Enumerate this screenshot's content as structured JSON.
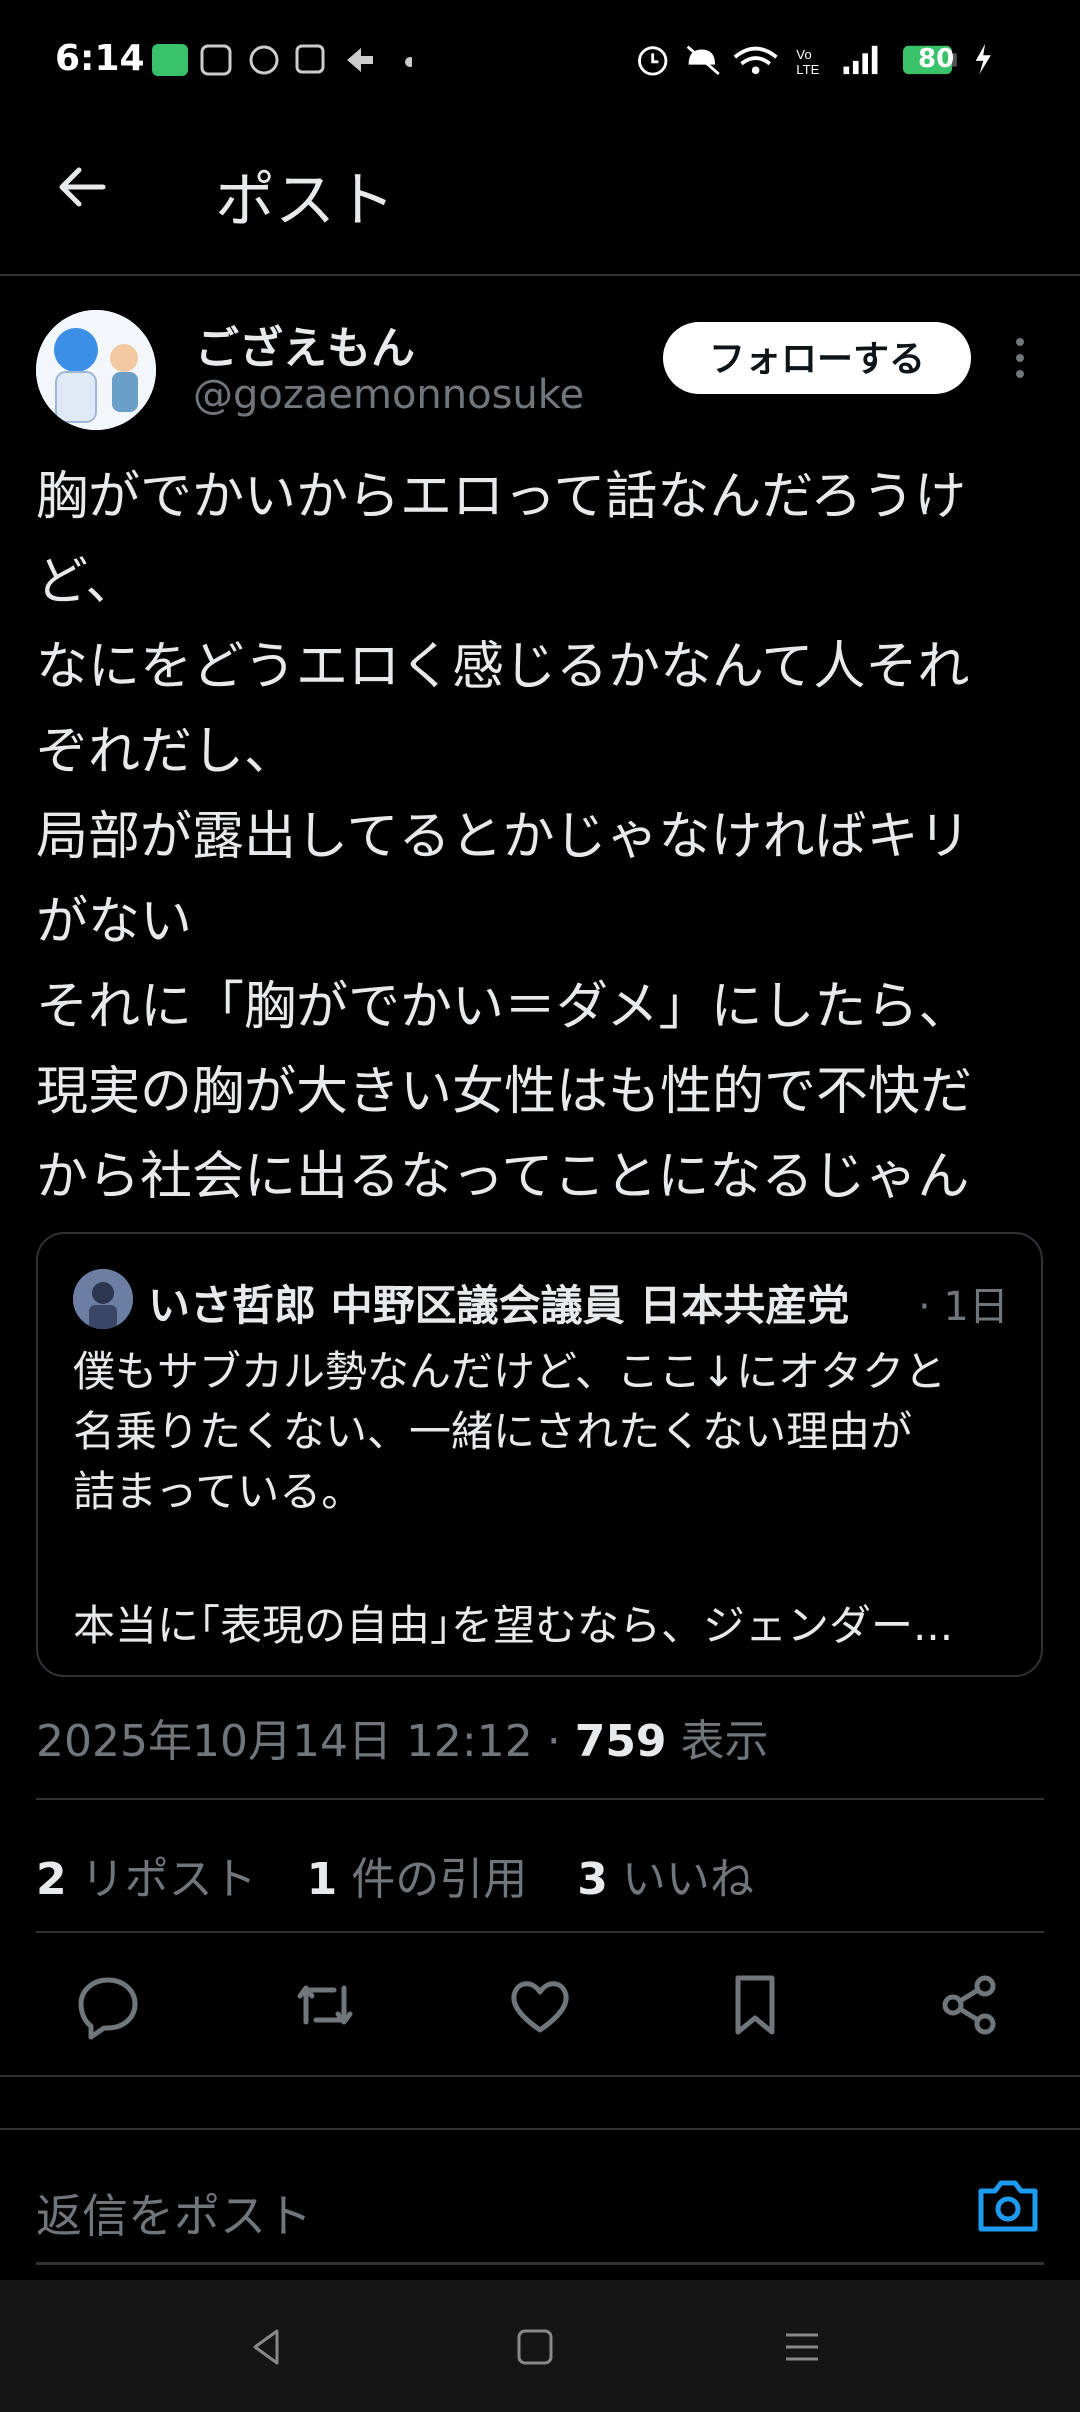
{
  "status_bar": {
    "time": "6:14",
    "battery": "80",
    "icons": [
      "notification-icon",
      "wifi-icon",
      "alarm-icon",
      "mute-icon",
      "volte-icon",
      "signal-icon",
      "battery-icon",
      "charging-icon"
    ]
  },
  "header": {
    "title": "ポスト"
  },
  "post": {
    "display_name": "ござえもん",
    "handle": "@gozaemonnosuke",
    "follow_label": "フォローする",
    "text_lines": [
      "胸がでかいからエロって話なんだろうけ",
      "ど、",
      "なにをどうエロく感じるかなんて人それ",
      "ぞれだし、",
      "局部が露出してるとかじゃなければキリ",
      "がない",
      "それに「胸がでかい＝ダメ」にしたら、",
      "現実の胸が大きい女性はも性的で不快だ",
      "から社会に出るなってことになるじゃん"
    ],
    "quote": {
      "author": "いさ哲郎 中野区議会議員 日本共産党",
      "time": "· 1日",
      "lines": [
        "僕もサブカル勢なんだけど、ここ↓にオタクと",
        "名乗りたくない、一緒にされたくない理由が",
        "詰まっている。"
      ],
      "last_line": "本当に｢表現の自由｣を望むなら、ジェンダー..."
    },
    "timestamp": "2025年10月14日 12:12 · ",
    "views_count": "759",
    "views_label": " 表示",
    "stats": {
      "reposts_count": "2",
      "reposts_label": " リポスト",
      "quotes_count": "1",
      "quotes_label": " 件の引用",
      "likes_count": "3",
      "likes_label": " いいね"
    }
  },
  "reply": {
    "placeholder": "返信をポスト"
  },
  "colors": {
    "background": "#000000",
    "text": "#e7e9ea",
    "muted": "#71767b",
    "divider": "#2f3336",
    "accent": "#1d9bf0"
  }
}
